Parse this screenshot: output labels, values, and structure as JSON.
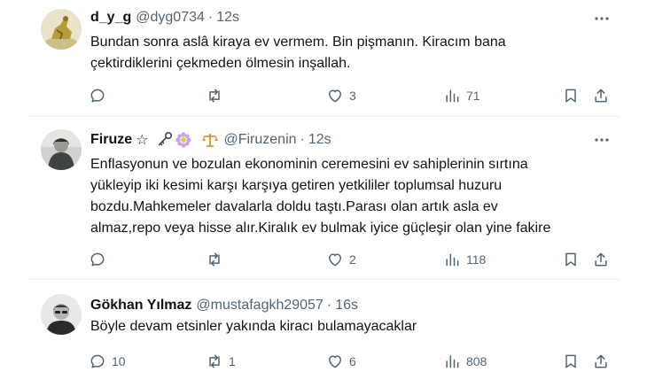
{
  "tweets": [
    {
      "name": "d_y_g",
      "handle": "@dyg0734",
      "time": "12s",
      "text_lines": [
        "Bundan sonra aslâ kiraya ev vermem. Bin pişmanın. Kiracım bana",
        "çektirdiklerini çekmeden ölmesin inşallah."
      ],
      "replies": "",
      "retweets": "",
      "likes": "3",
      "views": "71"
    },
    {
      "name": "Firuze",
      "name_suffix": "☆",
      "badges": [
        "key-icon",
        "flower-icon",
        "scales-icon"
      ],
      "handle": "@Firuzenin",
      "time": "12s",
      "text_lines": [
        "Enflasyonun ve bozulan ekonominin ceremesini ev sahiplerinin sırtına",
        "yükleyip iki kesimi karşı karşıya getiren yetkililer toplumsal huzuru",
        "bozdu.Mahkemeler davalarla doldu taştı.Parası olan artık asla ev",
        "almaz,repo veya hisse alır.Kiralık ev bulmak iyice güçleşir olan yine fakire"
      ],
      "replies": "",
      "retweets": "",
      "likes": "2",
      "views": "118"
    },
    {
      "name": "Gökhan Yılmaz",
      "handle": "@mustafagkh29057",
      "time": "16s",
      "text_lines": [
        "Böyle devam etsinler yakında kiracı bulamayacaklar"
      ],
      "replies": "10",
      "retweets": "1",
      "likes": "6",
      "views": "808"
    }
  ],
  "colors": {
    "text": "#0f1419",
    "secondary": "#536471",
    "divider": "#eff3f4"
  }
}
